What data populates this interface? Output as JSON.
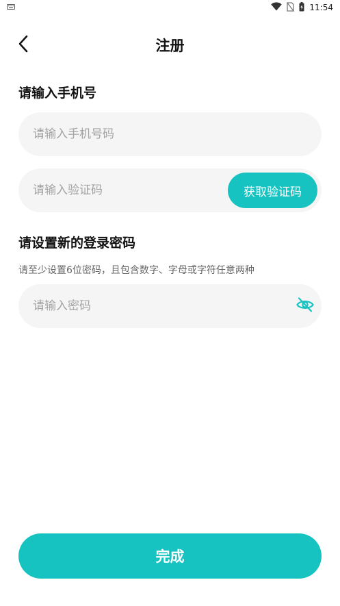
{
  "status_bar": {
    "time": "11:54",
    "icons": [
      "keyboard-icon",
      "wifi-icon",
      "no-sim-icon",
      "battery-charging-icon"
    ]
  },
  "header": {
    "title": "注册",
    "back_icon": "chevron-left-icon"
  },
  "phone_section": {
    "label": "请输入手机号",
    "phone_placeholder": "请输入手机号码",
    "code_placeholder": "请输入验证码",
    "get_code_label": "获取验证码"
  },
  "password_section": {
    "label": "请设置新的登录密码",
    "hint": "请至少设置6位密码，且包含数字、字母或字符任意两种",
    "password_placeholder": "请输入密码",
    "toggle_icon": "eye-off-icon"
  },
  "submit": {
    "label": "完成"
  },
  "colors": {
    "accent": "#17c3c1",
    "input_bg": "#f5f5f5",
    "placeholder": "#a3a3a3"
  }
}
